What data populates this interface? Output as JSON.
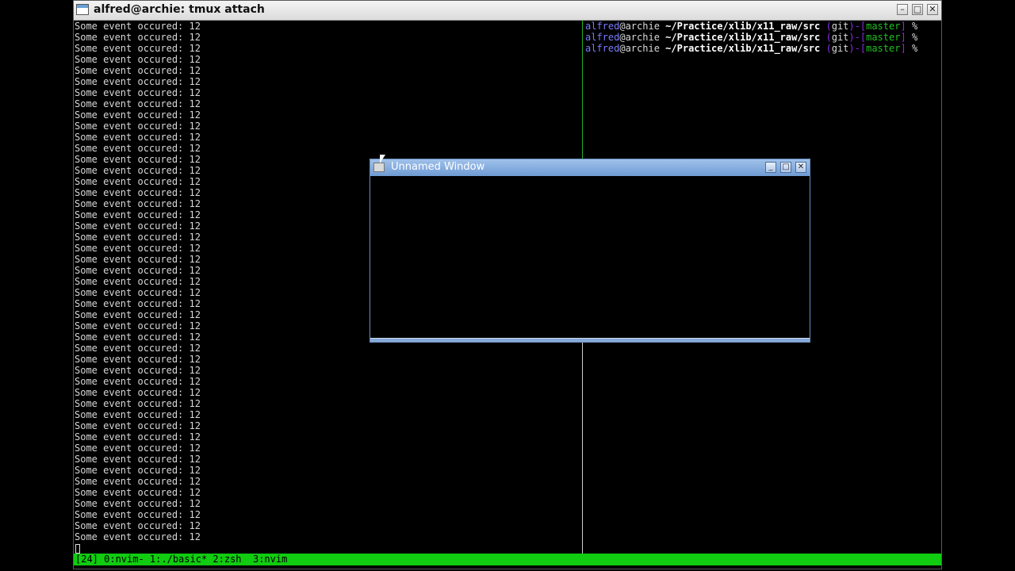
{
  "window": {
    "title": "alfred@archie: tmux attach",
    "buttons": {
      "minimize": "–",
      "maximize": "□",
      "close": "✕"
    }
  },
  "left_pane": {
    "lines": [
      "Some event occured: 12",
      "Some event occured: 12",
      "Some event occured: 12",
      "Some event occured: 12",
      "Some event occured: 12",
      "Some event occured: 12",
      "Some event occured: 12",
      "Some event occured: 12",
      "Some event occured: 12",
      "Some event occured: 12",
      "Some event occured: 12",
      "Some event occured: 12",
      "Some event occured: 12",
      "Some event occured: 12",
      "Some event occured: 12",
      "Some event occured: 12",
      "Some event occured: 12",
      "Some event occured: 12",
      "Some event occured: 12",
      "Some event occured: 12",
      "Some event occured: 12",
      "Some event occured: 12",
      "Some event occured: 12",
      "Some event occured: 12",
      "Some event occured: 12",
      "Some event occured: 12",
      "Some event occured: 12",
      "Some event occured: 12",
      "Some event occured: 12",
      "Some event occured: 12",
      "Some event occured: 12",
      "Some event occured: 12",
      "Some event occured: 12",
      "Some event occured: 12",
      "Some event occured: 12",
      "Some event occured: 12",
      "Some event occured: 12",
      "Some event occured: 12",
      "Some event occured: 12",
      "Some event occured: 12",
      "Some event occured: 12",
      "Some event occured: 12",
      "Some event occured: 12",
      "Some event occured: 12",
      "Some event occured: 12",
      "Some event occured: 12",
      "Some event occured: 12"
    ]
  },
  "right_pane": {
    "prompts": [
      {
        "user": "alfred",
        "host": "@archie",
        "path": "~/Practice/xlib/x11_raw/src",
        "git": "git",
        "branch": "master",
        "symbol": "%"
      },
      {
        "user": "alfred",
        "host": "@archie",
        "path": "~/Practice/xlib/x11_raw/src",
        "git": "git",
        "branch": "master",
        "symbol": "%"
      },
      {
        "user": "alfred",
        "host": "@archie",
        "path": "~/Practice/xlib/x11_raw/src",
        "git": "git",
        "branch": "master",
        "symbol": "%"
      }
    ]
  },
  "status_bar": {
    "text": "[24] 0:nvim- 1:./basic* 2:zsh  3:nvim",
    "color": "#11cc11"
  },
  "popup": {
    "title": "Unnamed Window",
    "buttons": {
      "minimize": "_",
      "maximize": "□",
      "close": "✕"
    }
  }
}
